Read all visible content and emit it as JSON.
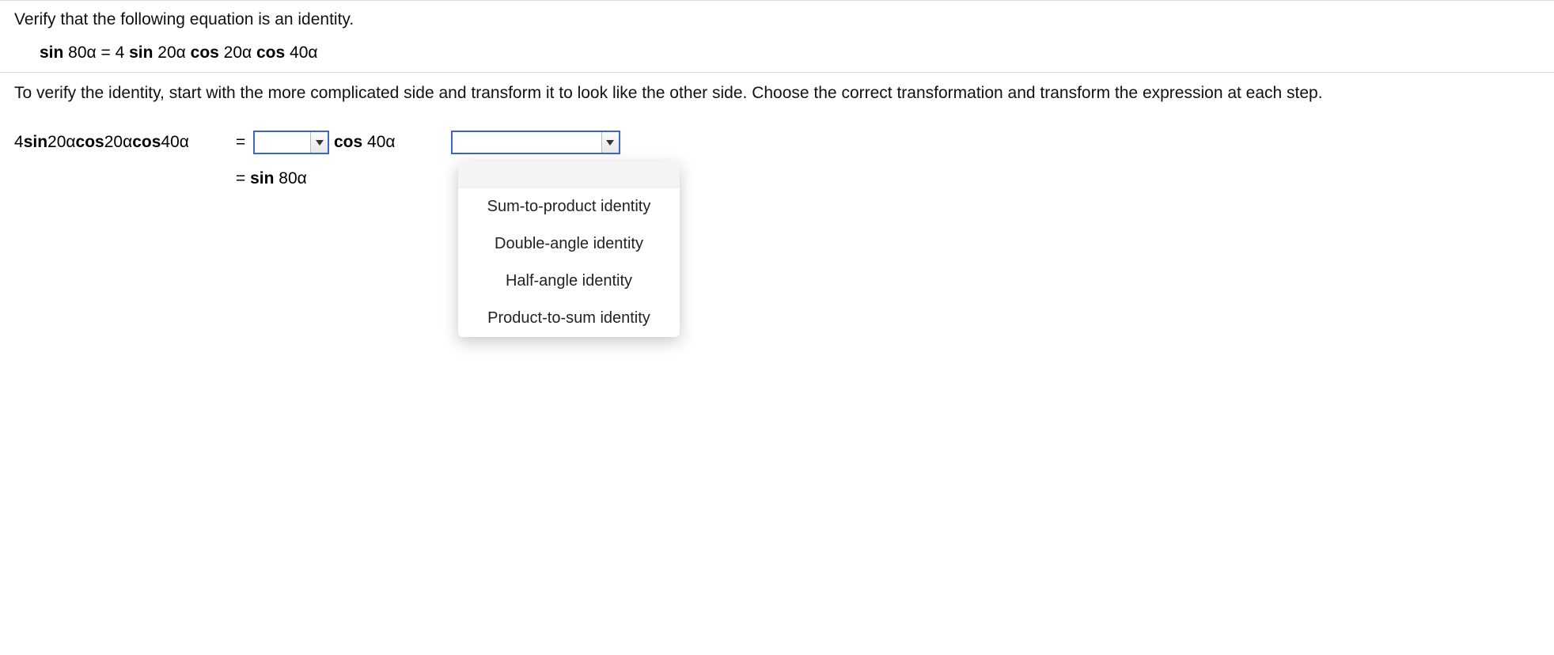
{
  "question": {
    "prompt": "Verify that the following equation is an identity.",
    "equation_prefix": "sin",
    "equation_arg1": " 80α = 4 ",
    "equation_mid1": "sin",
    "equation_arg2": " 20α ",
    "equation_mid2": "cos",
    "equation_arg3": " 20α ",
    "equation_mid3": "cos",
    "equation_arg4": " 40α"
  },
  "instructions": "To verify the identity, start with the more complicated side and transform it to look like the other side. Choose the correct transformation and transform the expression at each step.",
  "work": {
    "lhs_prefix": "4 ",
    "lhs_sin": "sin",
    "lhs_a1": " 20α ",
    "lhs_cos1": "cos",
    "lhs_a2": " 20α ",
    "lhs_cos2": "cos",
    "lhs_a3": " 40α",
    "equals": "=",
    "after_combo1_b": "cos",
    "after_combo1_t": " 40α",
    "row2_eq": "= ",
    "row2_b": "sin",
    "row2_t": " 80α"
  },
  "combo1": {
    "value": ""
  },
  "combo2": {
    "value": ""
  },
  "dropdown": {
    "blank": "",
    "items": [
      "Sum-to-product identity",
      "Double-angle identity",
      "Half-angle identity",
      "Product-to-sum identity"
    ]
  }
}
